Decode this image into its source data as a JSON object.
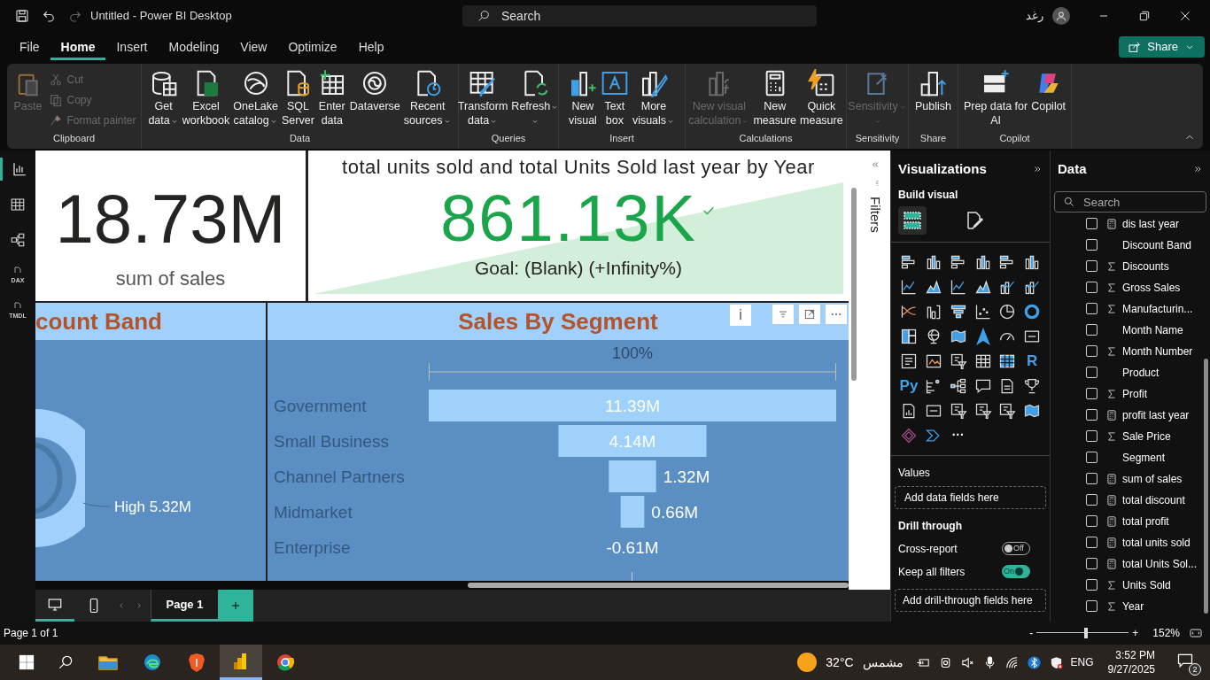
{
  "window": {
    "title": "Untitled - Power BI Desktop",
    "user": "رغد"
  },
  "search": {
    "placeholder": "Search"
  },
  "menu": [
    {
      "label": "File",
      "selected": false
    },
    {
      "label": "Home",
      "selected": true
    },
    {
      "label": "Insert",
      "selected": false
    },
    {
      "label": "Modeling",
      "selected": false
    },
    {
      "label": "View",
      "selected": false
    },
    {
      "label": "Optimize",
      "selected": false
    },
    {
      "label": "Help",
      "selected": false
    }
  ],
  "share_button": {
    "label": "Share"
  },
  "ribbon": [
    {
      "label": "Clipboard",
      "buttons": [
        {
          "kind": "paste",
          "lines": [
            "Paste"
          ],
          "disabled": true,
          "dropdown": false
        }
      ],
      "small_buttons": [
        {
          "kind": "cut",
          "label": "Cut",
          "disabled": true
        },
        {
          "kind": "copy",
          "label": "Copy",
          "disabled": true
        },
        {
          "kind": "brush",
          "label": "Format painter",
          "disabled": true
        }
      ]
    },
    {
      "label": "Data",
      "buttons": [
        {
          "kind": "database",
          "lines": [
            "Get",
            "data"
          ],
          "disabled": false,
          "dropdown": true
        },
        {
          "kind": "excel",
          "lines": [
            "Excel",
            "workbook"
          ],
          "disabled": false,
          "dropdown": false
        },
        {
          "kind": "onelake",
          "lines": [
            "OneLake",
            "catalog"
          ],
          "disabled": false,
          "dropdown": true
        },
        {
          "kind": "sql",
          "lines": [
            "SQL",
            "Server"
          ],
          "disabled": false,
          "dropdown": false
        },
        {
          "kind": "grid",
          "lines": [
            "Enter",
            "data"
          ],
          "disabled": false,
          "dropdown": false
        },
        {
          "kind": "swirl",
          "lines": [
            "Dataverse"
          ],
          "disabled": false,
          "dropdown": false
        },
        {
          "kind": "clock",
          "lines": [
            "Recent",
            "sources"
          ],
          "disabled": false,
          "dropdown": true
        }
      ]
    },
    {
      "label": "Queries",
      "buttons": [
        {
          "kind": "transform",
          "lines": [
            "Transform",
            "data"
          ],
          "disabled": false,
          "dropdown": true
        },
        {
          "kind": "refresh",
          "lines": [
            "Refresh"
          ],
          "disabled": false,
          "dropdown": true
        }
      ]
    },
    {
      "label": "Insert",
      "buttons": [
        {
          "kind": "newvisual",
          "lines": [
            "New",
            "visual"
          ],
          "disabled": false,
          "dropdown": false
        },
        {
          "kind": "textbox",
          "lines": [
            "Text",
            "box"
          ],
          "disabled": false,
          "dropdown": false
        },
        {
          "kind": "morevisuals",
          "lines": [
            "More",
            "visuals"
          ],
          "disabled": false,
          "dropdown": true
        }
      ]
    },
    {
      "label": "Calculations",
      "buttons": [
        {
          "kind": "fx",
          "lines": [
            "New visual",
            "calculation"
          ],
          "disabled": true,
          "dropdown": true
        },
        {
          "kind": "calculator",
          "lines": [
            "New",
            "measure"
          ],
          "disabled": false,
          "dropdown": false
        },
        {
          "kind": "quick",
          "lines": [
            "Quick",
            "measure"
          ],
          "disabled": false,
          "dropdown": false
        }
      ]
    },
    {
      "label": "Sensitivity",
      "buttons": [
        {
          "kind": "label",
          "lines": [
            "Sensitivity"
          ],
          "disabled": true,
          "dropdown": true
        }
      ]
    },
    {
      "label": "Share",
      "buttons": [
        {
          "kind": "publish",
          "lines": [
            "Publish"
          ],
          "disabled": false,
          "dropdown": false
        }
      ]
    },
    {
      "label": "Copilot",
      "buttons": [
        {
          "kind": "prep",
          "lines": [
            "Prep data for",
            "AI"
          ],
          "disabled": false,
          "dropdown": false
        },
        {
          "kind": "copilot",
          "lines": [
            "Copilot"
          ],
          "disabled": false,
          "dropdown": false
        }
      ]
    }
  ],
  "nav": [
    {
      "kind": "report",
      "selected": true
    },
    {
      "kind": "table",
      "selected": false
    },
    {
      "kind": "model",
      "selected": false
    },
    {
      "kind": "doc",
      "label": "DAX",
      "selected": false
    },
    {
      "kind": "doc",
      "label": "TMDL",
      "selected": false
    }
  ],
  "card": {
    "value": "18.73M",
    "label": "sum of sales"
  },
  "kpi": {
    "title": "total units sold and total Units Sold last year by Year",
    "value": "861.13K",
    "goal": "Goal: (Blank) (+Infinity%)"
  },
  "donut_visual": {
    "title": "count Band",
    "slice_label": "High 5.32M"
  },
  "funnel_visual": {
    "title": "Sales By Segment",
    "info_button": "i",
    "percent_label": "100%",
    "segments": [
      {
        "label": "Government",
        "value": "11.39M"
      },
      {
        "label": "Small Business",
        "value": "4.14M"
      },
      {
        "label": "Channel Partners",
        "value": "1.32M"
      },
      {
        "label": "Midmarket",
        "value": "0.66M"
      },
      {
        "label": "Enterprise",
        "value": "-0.61M"
      }
    ]
  },
  "filters_pane": {
    "title": "Filters"
  },
  "page_tabs": [
    {
      "label": "Page 1",
      "selected": true
    }
  ],
  "visualizations": {
    "title": "Visualizations",
    "subtitle": "Build visual",
    "tabs": [
      {
        "kind": "build",
        "selected": true
      },
      {
        "kind": "format",
        "selected": false
      }
    ],
    "gallery": [
      {
        "kind": "bar-h"
      },
      {
        "kind": "bar-v"
      },
      {
        "kind": "bar-h"
      },
      {
        "kind": "bar-v"
      },
      {
        "kind": "bar-h"
      },
      {
        "kind": "bar-v"
      },
      {
        "kind": "line"
      },
      {
        "kind": "area"
      },
      {
        "kind": "line"
      },
      {
        "kind": "area"
      },
      {
        "kind": "combo"
      },
      {
        "kind": "combo"
      },
      {
        "kind": "ribbon"
      },
      {
        "kind": "waterfall"
      },
      {
        "kind": "funnel"
      },
      {
        "kind": "scatter"
      },
      {
        "kind": "pie"
      },
      {
        "kind": "donut"
      },
      {
        "kind": "treemap"
      },
      {
        "kind": "globe"
      },
      {
        "kind": "map"
      },
      {
        "kind": "arrow"
      },
      {
        "kind": "gauge"
      },
      {
        "kind": "card"
      },
      {
        "kind": "list"
      },
      {
        "kind": "image"
      },
      {
        "kind": "slicer"
      },
      {
        "kind": "table"
      },
      {
        "kind": "matrix"
      },
      {
        "kind": "script",
        "label": "R"
      },
      {
        "kind": "script",
        "label": "Py"
      },
      {
        "kind": "influencers"
      },
      {
        "kind": "tree"
      },
      {
        "kind": "bubble"
      },
      {
        "kind": "doc"
      },
      {
        "kind": "trophy"
      },
      {
        "kind": "report"
      },
      {
        "kind": "card"
      },
      {
        "kind": "slicer"
      },
      {
        "kind": "slicer"
      },
      {
        "kind": "slicer"
      },
      {
        "kind": "map"
      },
      {
        "kind": "diamond"
      },
      {
        "kind": "chevron"
      },
      {
        "kind": "more",
        "label": "···"
      }
    ],
    "values_label": "Values",
    "values_placeholder": "Add data fields here",
    "drill_title": "Drill through",
    "toggles": [
      {
        "label": "Cross-report",
        "on": false,
        "text": "Off"
      },
      {
        "label": "Keep all filters",
        "on": true,
        "text": "On"
      }
    ],
    "drill_placeholder": "Add drill-through fields here"
  },
  "data_pane": {
    "title": "Data",
    "search_placeholder": "Search",
    "fields": [
      {
        "label": "dis last year",
        "kind": "measure",
        "checked": false
      },
      {
        "label": "Discount Band",
        "kind": "text",
        "checked": false
      },
      {
        "label": "Discounts",
        "kind": "sum",
        "checked": false
      },
      {
        "label": "Gross Sales",
        "kind": "sum",
        "checked": false
      },
      {
        "label": "Manufacturin...",
        "kind": "sum",
        "checked": false
      },
      {
        "label": "Month Name",
        "kind": "text",
        "checked": false
      },
      {
        "label": "Month Number",
        "kind": "sum",
        "checked": false
      },
      {
        "label": "Product",
        "kind": "text",
        "checked": false
      },
      {
        "label": "Profit",
        "kind": "sum",
        "checked": false
      },
      {
        "label": "profit last year",
        "kind": "measure",
        "checked": false
      },
      {
        "label": "Sale Price",
        "kind": "sum",
        "checked": false
      },
      {
        "label": "Segment",
        "kind": "text",
        "checked": false
      },
      {
        "label": "sum of sales",
        "kind": "measure",
        "checked": false
      },
      {
        "label": "total discount",
        "kind": "measure",
        "checked": false
      },
      {
        "label": "total profit",
        "kind": "measure",
        "checked": false
      },
      {
        "label": "total units sold",
        "kind": "measure",
        "checked": false
      },
      {
        "label": "total Units Sol...",
        "kind": "measure",
        "checked": false
      },
      {
        "label": "Units Sold",
        "kind": "sum",
        "checked": false
      },
      {
        "label": "Year",
        "kind": "sum",
        "checked": false
      }
    ]
  },
  "status_bar": {
    "page": "Page 1 of 1",
    "minus": "-",
    "plus": "+",
    "zoom": {
      "level": 0.54
    },
    "zoom_text": "152%"
  },
  "taskbar": {
    "apps": [
      {
        "kind": "folder",
        "selected": false
      },
      {
        "kind": "edge",
        "selected": false
      },
      {
        "kind": "brave",
        "selected": false
      },
      {
        "kind": "powerbi",
        "selected": true
      },
      {
        "kind": "chrome",
        "selected": false
      }
    ],
    "temperature": "32°C",
    "condition": "مشمس",
    "language": "ENG",
    "time": "3:52 PM",
    "date": "9/27/2025",
    "notifications": "2"
  }
}
